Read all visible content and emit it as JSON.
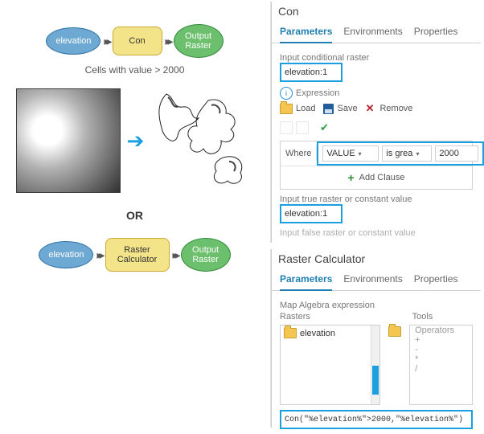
{
  "flow1": {
    "in": "elevation",
    "mid": "Con",
    "out": "Output\nRaster"
  },
  "flow2": {
    "in": "elevation",
    "mid": "Raster Calculator",
    "out": "Output\nRaster"
  },
  "cells_label": "Cells with value > 2000",
  "or": "OR",
  "con": {
    "title": "Con",
    "tabs": [
      "Parameters",
      "Environments",
      "Properties"
    ],
    "input_cond_label": "Input conditional raster",
    "input_cond_value": "elevation:1",
    "expression_label": "Expression",
    "load": "Load",
    "save": "Save",
    "remove": "Remove",
    "where": "Where",
    "field": "VALUE",
    "op": "is grea",
    "val": "2000",
    "add_clause": "Add Clause",
    "input_true_label": "Input true raster or constant value",
    "input_true_value": "elevation:1",
    "input_false_label": "Input false raster or constant value"
  },
  "rc": {
    "title": "Raster Calculator",
    "tabs": [
      "Parameters",
      "Environments",
      "Properties"
    ],
    "map_label": "Map Algebra expression",
    "rasters_head": "Rasters",
    "tools_head": "Tools",
    "raster_item": "elevation",
    "ops_head": "Operators",
    "ops": [
      "+",
      "-",
      "*",
      "/"
    ],
    "expr": "Con(\"%elevation%\">2000,\"%elevation%\")"
  }
}
